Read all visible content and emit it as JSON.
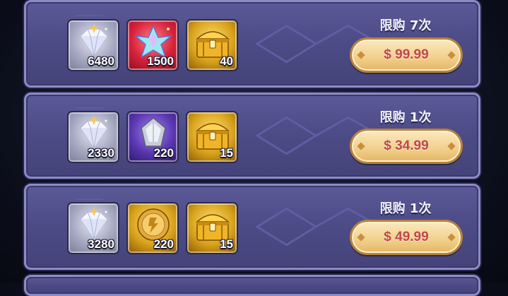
{
  "offers": [
    {
      "limit_label": "限购 7次",
      "price_label": "$ 99.99",
      "items": [
        {
          "icon": "diamond-icon",
          "quantity": "6480"
        },
        {
          "icon": "crystal-star-icon",
          "quantity": "1500"
        },
        {
          "icon": "treasure-chest-icon",
          "quantity": "40"
        }
      ]
    },
    {
      "limit_label": "限购 1次",
      "price_label": "$ 34.99",
      "items": [
        {
          "icon": "diamond-icon",
          "quantity": "2330"
        },
        {
          "icon": "silver-gem-icon",
          "quantity": "220"
        },
        {
          "icon": "treasure-chest-icon",
          "quantity": "15"
        }
      ]
    },
    {
      "limit_label": "限购 1次",
      "price_label": "$ 49.99",
      "items": [
        {
          "icon": "diamond-icon",
          "quantity": "3280"
        },
        {
          "icon": "gold-coin-icon",
          "quantity": "220"
        },
        {
          "icon": "treasure-chest-icon",
          "quantity": "15"
        }
      ]
    }
  ],
  "colors": {
    "panel": "#4f4e8a",
    "panel_border": "#8c8bc7",
    "price_button": "#f1cf8a",
    "price_text": "#c0464d",
    "rarity_gray": "#a6a8c1",
    "rarity_red": "#d7223a",
    "rarity_gold": "#d8a21b",
    "rarity_purple": "#5a36b0"
  }
}
